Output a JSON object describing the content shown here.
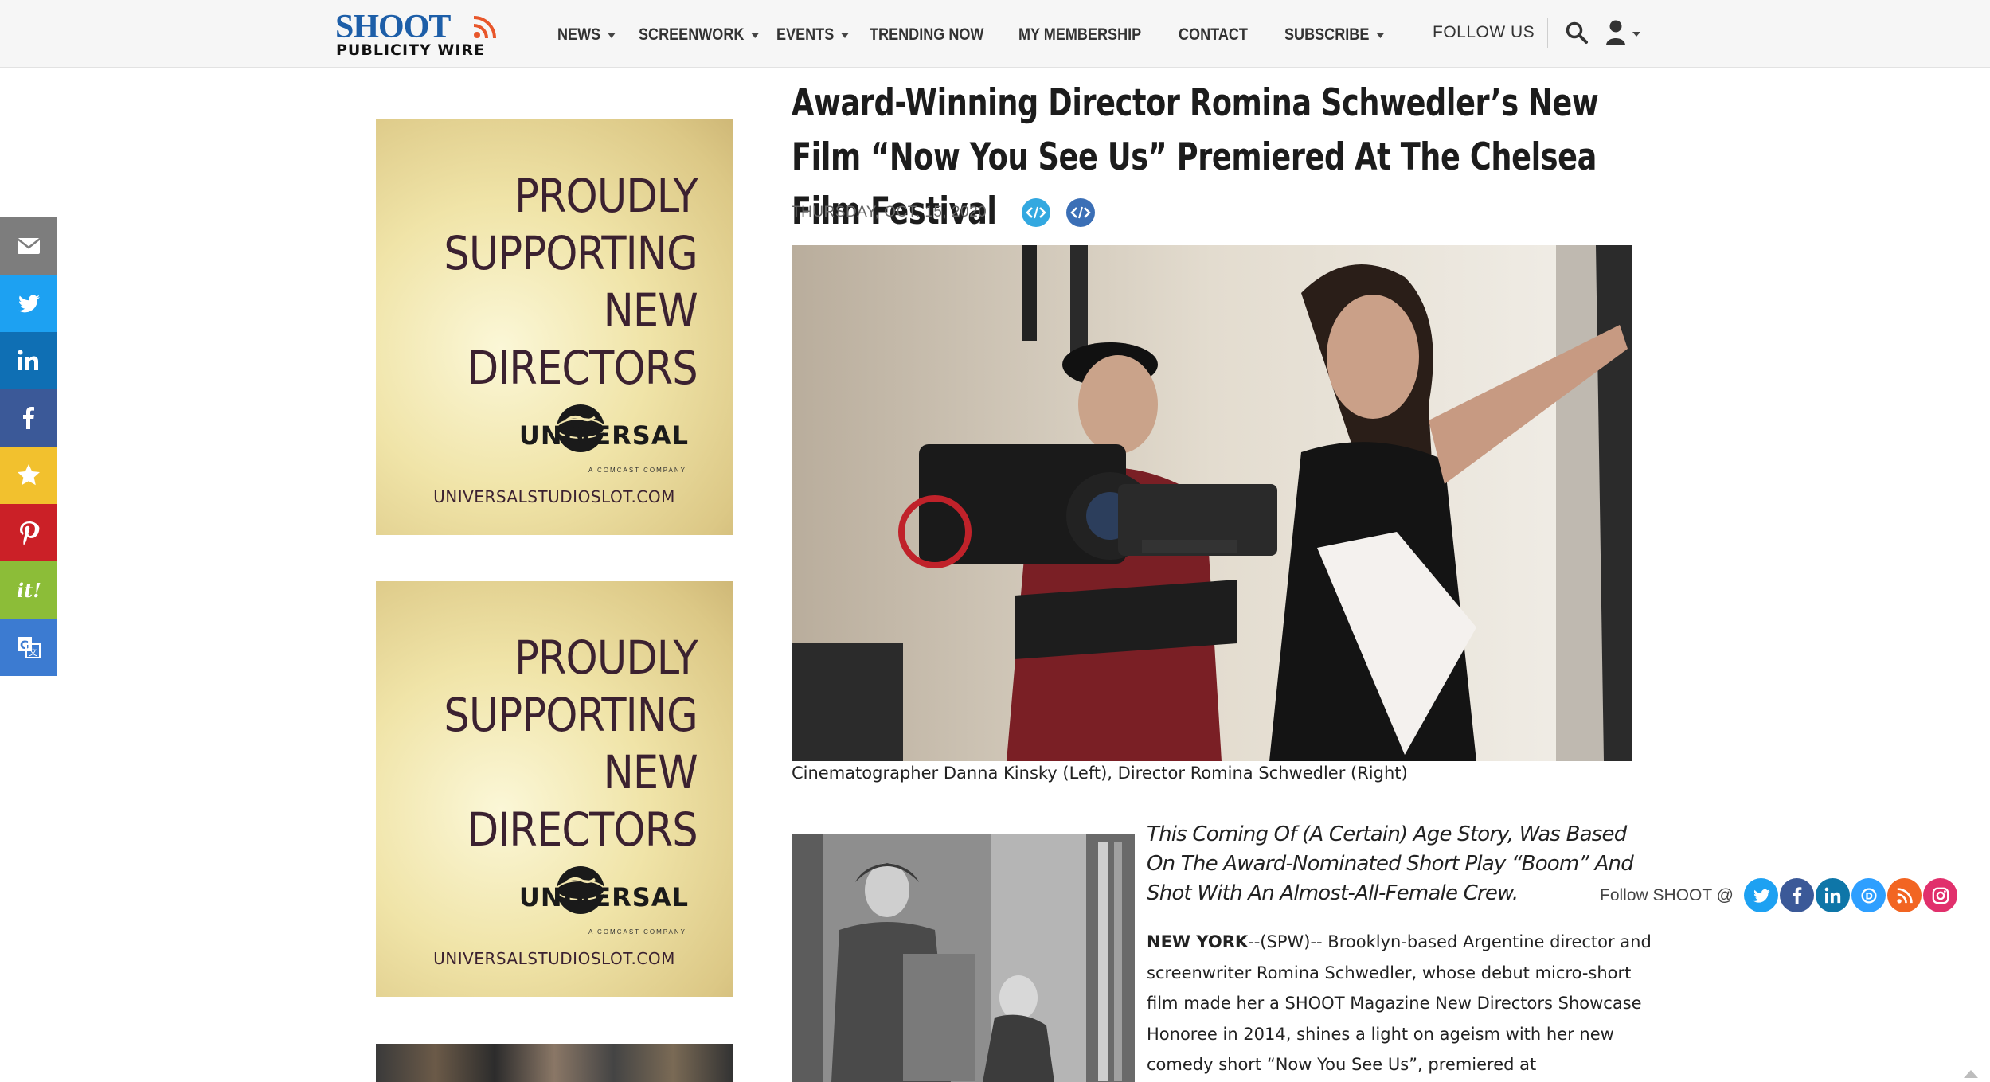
{
  "header": {
    "logo_line1": "SHOOT",
    "logo_line2": "PUBLICITY WIRE",
    "nav": [
      {
        "label": "NEWS"
      },
      {
        "label": "SCREENWORK"
      },
      {
        "label": "EVENTS"
      },
      {
        "label": "TRENDING NOW"
      },
      {
        "label": "MY MEMBERSHIP"
      },
      {
        "label": "CONTACT"
      },
      {
        "label": "SUBSCRIBE"
      }
    ],
    "follow_label": "FOLLOW US"
  },
  "share_rail": {
    "items": [
      "email-icon",
      "twitter-icon",
      "linkedin-icon",
      "facebook-icon",
      "favorite-star-icon",
      "pinterest-icon",
      "scoopit-icon",
      "google-translate-icon"
    ],
    "colors": [
      "#7d7d7d",
      "#1da1f2",
      "#0f6fb4",
      "#3b5998",
      "#f2c12e",
      "#cb2027",
      "#8cbd38",
      "#3c7bd1"
    ]
  },
  "ads": {
    "tagline_lines": [
      "PROUDLY",
      "SUPPORTING",
      "NEW",
      "DIRECTORS"
    ],
    "brand": "UNIVERSAL",
    "brand_sub": "A COMCAST COMPANY",
    "url": "UNIVERSALSTUDIOSLOT.COM"
  },
  "article": {
    "title": "Award-Winning Director Romina Schwedler’s New Film “Now You See Us” Premiered At The Chelsea Film Festival",
    "date": "THURSDAY, OCT. 15, 2020",
    "hero_caption": "Cinematographer Danna Kinsky (Left), Director Romina Schwedler (Right)",
    "lede": "This Coming Of (A Certain) Age Story, Was Based On The Award-Nominated Short Play “Boom” And Shot With An Almost-All-Female Crew.",
    "dateline": "NEW YORK",
    "dateline_suffix": "--(SPW)--",
    "body": " Brooklyn-based Argentine director and screenwriter Romina Schwedler, whose debut micro-short film made her a SHOOT Magazine New Directors Showcase Honoree in 2014, shines a light on ageism with her new comedy short “Now You See Us”, premiered at"
  },
  "follow_shoot": {
    "label": "Follow SHOOT @",
    "icons": [
      "twitter-icon",
      "facebook-icon",
      "linkedin-icon",
      "disqus-icon",
      "rss-icon",
      "instagram-icon"
    ],
    "colors": [
      "#1da1f2",
      "#3b5998",
      "#0e76a8",
      "#2e9fff",
      "#f26522",
      "#e1306c"
    ]
  }
}
